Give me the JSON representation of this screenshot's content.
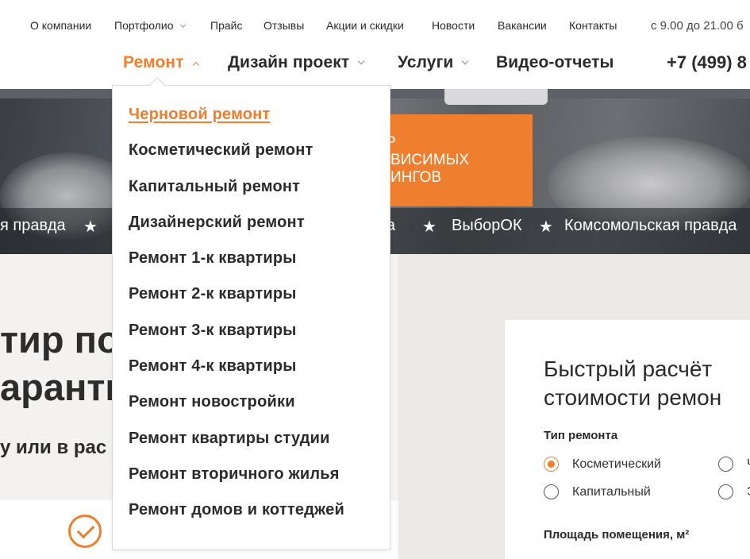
{
  "topbar": {
    "links": [
      "О компании",
      "Портфолио",
      "Прайс",
      "Отзывы",
      "Акции и скидки",
      "Новости",
      "Вакансии",
      "Контакты"
    ],
    "hours": "с 9.00 до 21.00 б"
  },
  "mainnav": {
    "items": [
      "Ремонт",
      "Дизайн проект",
      "Услуги",
      "Видео-отчеты"
    ],
    "phone": "+7 (499) 8"
  },
  "dropdown": {
    "items": [
      "Черновой ремонт",
      "Косметический ремонт",
      "Капитальный ремонт",
      "Дизайнерский ремонт",
      "Ремонт 1-к квартиры",
      "Ремонт 2-к квартиры",
      "Ремонт 3-к квартиры",
      "Ремонт 4-к квартиры",
      "Ремонт новостройки",
      "Ремонт квартиры студии",
      "Ремонт вторичного жилья",
      "Ремонт домов и коттеджей"
    ],
    "active_index": 0
  },
  "hero": {
    "banner_lines": [
      "Р",
      "ВИСИМЫХ",
      "ИНГОВ"
    ],
    "ticker": [
      "я правда",
      "★",
      "та",
      "★",
      "ВыборОК",
      "★",
      "Комсомольская правда"
    ]
  },
  "content": {
    "headline_line1": "тир по",
    "headline_line2": "аранти",
    "subline": "у или в рас"
  },
  "calculator": {
    "title_line1": "Быстрый расчёт",
    "title_line2": "стоимости ремон",
    "repair_type_label": "Тип ремонта",
    "options": [
      {
        "label": "Косметический",
        "checked": true
      },
      {
        "label": "Ч",
        "checked": false
      },
      {
        "label": "Капитальный",
        "checked": false
      },
      {
        "label": "Э",
        "checked": false
      }
    ],
    "area_label": "Площадь помещения, м²"
  },
  "colors": {
    "accent": "#ef7f2f",
    "text": "#2b2b2b"
  }
}
